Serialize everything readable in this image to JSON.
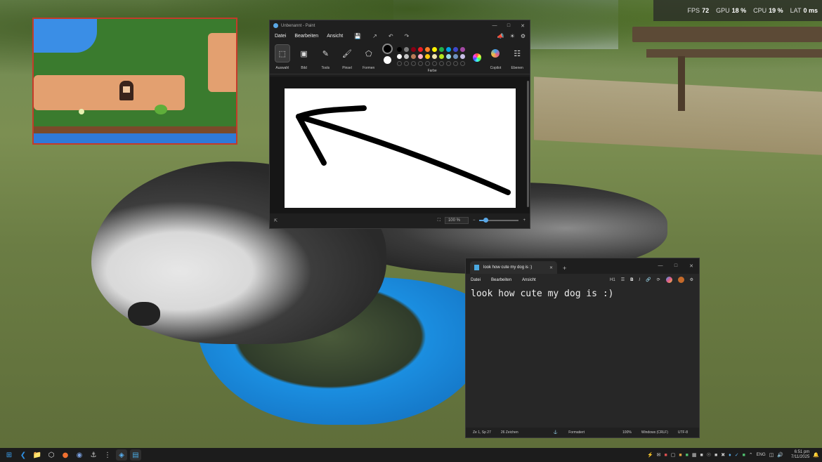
{
  "perf_overlay": {
    "fps_label": "FPS",
    "fps_value": "72",
    "gpu_label": "GPU",
    "gpu_value": "18 %",
    "cpu_label": "CPU",
    "cpu_value": "19 %",
    "lat_label": "LAT",
    "lat_value": "0 ms"
  },
  "paint": {
    "title": "Unbenannt - Paint",
    "menu": [
      "Datei",
      "Bearbeiten",
      "Ansicht"
    ],
    "ribbon": {
      "auswahl": "Auswahl",
      "bild": "Bild",
      "tools": "Tools",
      "pinsel": "Pinsel",
      "formen": "Formen",
      "farbe": "Farbe",
      "copilot": "Copilot",
      "ebenen": "Ebenen"
    },
    "color_rows": [
      [
        "#000000",
        "#7f7f7f",
        "#880015",
        "#ed1c24",
        "#ff7f27",
        "#fff200",
        "#22b14c",
        "#00a2e8",
        "#3f48cc",
        "#a349a4"
      ],
      [
        "#ffffff",
        "#c3c3c3",
        "#b97a57",
        "#ffaec9",
        "#ffc90e",
        "#efe4b0",
        "#b5e61d",
        "#99d9ea",
        "#7092be",
        "#c8bfe7"
      ]
    ],
    "primary_color": "#000000",
    "secondary_color": "#ffffff",
    "zoom": "100 %",
    "zoom_fraction": 0.15
  },
  "notepad": {
    "tab_title": "look how cute my dog is :)",
    "menu": [
      "Datei",
      "Bearbeiten",
      "Ansicht"
    ],
    "heading": "H1",
    "bold": "B",
    "italic": "I",
    "content": "look how cute my dog is :)",
    "status": {
      "position": "Ze 1, Sp 27",
      "chars": "26 Zeichen",
      "format": "Formatiert",
      "zoom": "100%",
      "line_ending": "Windows (CRLF)",
      "encoding": "UTF-8"
    }
  },
  "taskbar": {
    "apps": [
      "windows-start",
      "vscode",
      "file-explorer",
      "unity",
      "firefox",
      "app",
      "steam",
      "terminal",
      "browser",
      "notepad"
    ],
    "language": "ENG",
    "time": "6:51 pm",
    "date": "7/11/2025"
  }
}
